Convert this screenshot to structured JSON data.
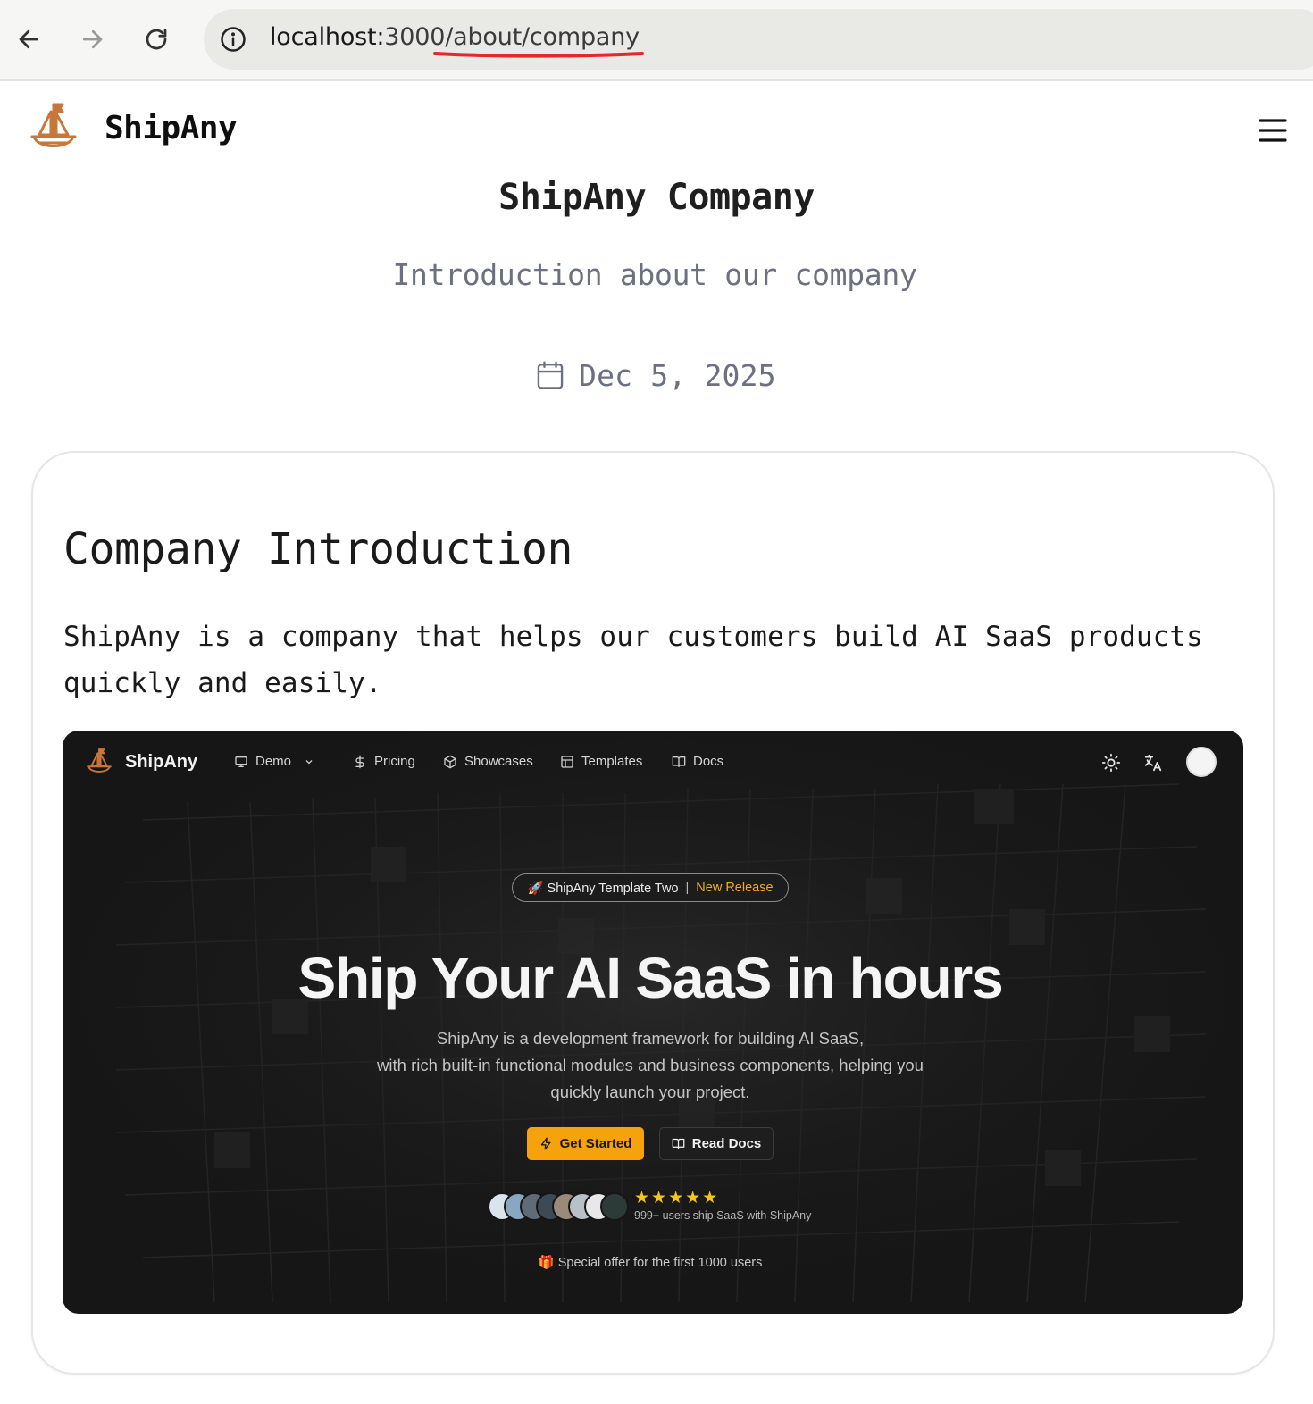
{
  "browser": {
    "url_host": "localhost:",
    "url_path": "3000/about/company"
  },
  "site": {
    "brand": "ShipAny"
  },
  "page": {
    "title": "ShipAny Company",
    "subtitle": "Introduction about our company",
    "date": "Dec 5, 2025"
  },
  "article": {
    "heading": "Company Introduction",
    "body": "ShipAny is a company that helps our customers build AI SaaS products quickly and easily."
  },
  "screenshot": {
    "brand": "ShipAny",
    "nav": [
      "Demo",
      "Pricing",
      "Showcases",
      "Templates",
      "Docs"
    ],
    "badge_left": "🚀 ShipAny Template Two",
    "badge_sep": "|",
    "badge_right": "New Release",
    "hero_title": "Ship Your AI SaaS in hours",
    "hero_desc_1": "ShipAny is a development framework for building AI SaaS,",
    "hero_desc_2": "with rich built-in functional modules and business components, helping you",
    "hero_desc_3": "quickly launch your project.",
    "cta_primary": "Get Started",
    "cta_secondary": "Read Docs",
    "rating": "★★★★★",
    "users": "999+ users ship SaaS with ShipAny",
    "offer": "🎁 Special offer for the first 1000 users"
  },
  "colors": {
    "accent": "#f5a20c",
    "logo": "#c8763a",
    "muted": "#6b7180"
  }
}
